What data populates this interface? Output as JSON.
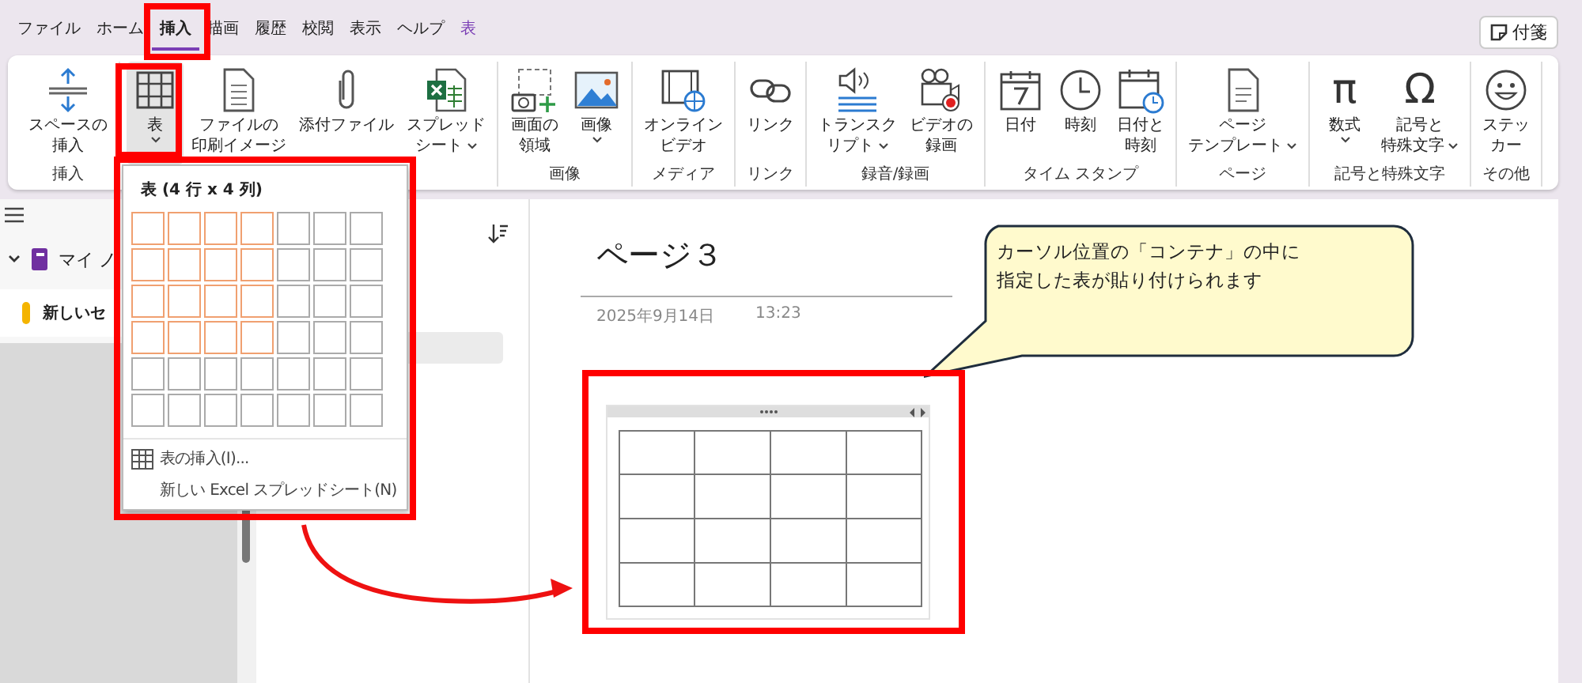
{
  "menu_tabs": [
    {
      "label": "ファイル",
      "selected": false,
      "kind": "normal"
    },
    {
      "label": "ホーム",
      "selected": false,
      "kind": "normal"
    },
    {
      "label": "挿入",
      "selected": true,
      "kind": "normal"
    },
    {
      "label": "描画",
      "selected": false,
      "kind": "normal"
    },
    {
      "label": "履歴",
      "selected": false,
      "kind": "normal"
    },
    {
      "label": "校閲",
      "selected": false,
      "kind": "normal"
    },
    {
      "label": "表示",
      "selected": false,
      "kind": "normal"
    },
    {
      "label": "ヘルプ",
      "selected": false,
      "kind": "normal"
    },
    {
      "label": "表",
      "selected": false,
      "kind": "contextual"
    }
  ],
  "sticky_notes_button": "付箋",
  "ribbon_groups": [
    {
      "items": [
        {
          "kind": "space",
          "lines": [
            "スペースの",
            "挿入"
          ],
          "dropdown": false,
          "selected": false
        }
      ],
      "label": "挿入"
    },
    {
      "items": [
        {
          "kind": "table",
          "lines": [
            "表"
          ],
          "dropdown": true,
          "selected": true
        },
        {
          "kind": "printout",
          "lines": [
            "ファイルの",
            "印刷イメージ"
          ],
          "dropdown": false,
          "selected": false
        },
        {
          "kind": "attachment",
          "lines": [
            "添付ファイル"
          ],
          "dropdown": false,
          "selected": false
        },
        {
          "kind": "spreadsheet",
          "lines": [
            "スプレッド",
            "シート"
          ],
          "dropdown": true,
          "selected": false
        }
      ]
    },
    {
      "items": [
        {
          "kind": "screen-clip",
          "lines": [
            "画面の",
            "領域"
          ],
          "dropdown": false,
          "selected": false
        },
        {
          "kind": "image",
          "lines": [
            "画像"
          ],
          "dropdown": true,
          "selected": false
        }
      ],
      "label": "画像"
    },
    {
      "items": [
        {
          "kind": "online-video",
          "lines": [
            "オンライン",
            "ビデオ"
          ],
          "dropdown": false,
          "selected": false
        }
      ],
      "label": "メディア"
    },
    {
      "items": [
        {
          "kind": "link",
          "lines": [
            "リンク"
          ],
          "dropdown": false,
          "selected": false
        }
      ],
      "label": "リンク"
    },
    {
      "items": [
        {
          "kind": "transcribe",
          "lines": [
            "トランスク",
            "リプト"
          ],
          "dropdown": true,
          "selected": false
        },
        {
          "kind": "video-record",
          "lines": [
            "ビデオの",
            "録画"
          ],
          "dropdown": false,
          "selected": false
        }
      ],
      "label": "録音/録画"
    },
    {
      "items": [
        {
          "kind": "date",
          "lines": [
            "日付"
          ],
          "dropdown": false,
          "selected": false
        },
        {
          "kind": "time",
          "lines": [
            "時刻"
          ],
          "dropdown": false,
          "selected": false
        },
        {
          "kind": "date-time",
          "lines": [
            "日付と",
            "時刻"
          ],
          "dropdown": false,
          "selected": false
        }
      ],
      "label": "タイム スタンプ"
    },
    {
      "items": [
        {
          "kind": "page-template",
          "lines": [
            "ページ",
            "テンプレート"
          ],
          "dropdown": true,
          "selected": false
        }
      ],
      "label": "ページ"
    },
    {
      "items": [
        {
          "kind": "glyph",
          "glyph": "π",
          "lines": [
            "数式"
          ],
          "dropdown": true,
          "selected": false
        },
        {
          "kind": "glyph",
          "glyph": "Ω",
          "lines": [
            "記号と",
            "特殊文字"
          ],
          "dropdown": true,
          "selected": false
        }
      ],
      "label": "記号と特殊文字"
    },
    {
      "items": [
        {
          "kind": "sticker",
          "lines": [
            "ステッ",
            "カー"
          ],
          "dropdown": false,
          "selected": false
        }
      ],
      "label": "その他"
    }
  ],
  "nav": {
    "notebook": "マイ ノ",
    "section": "新しいセ"
  },
  "table_dropdown": {
    "title": "表 (4 行 x 4 列)",
    "grid": [
      {
        "cells": [
          {
            "selected": true
          },
          {
            "selected": true
          },
          {
            "selected": true
          },
          {
            "selected": true
          },
          {
            "selected": false
          },
          {
            "selected": false
          },
          {
            "selected": false
          }
        ]
      },
      {
        "cells": [
          {
            "selected": true
          },
          {
            "selected": true
          },
          {
            "selected": true
          },
          {
            "selected": true
          },
          {
            "selected": false
          },
          {
            "selected": false
          },
          {
            "selected": false
          }
        ]
      },
      {
        "cells": [
          {
            "selected": true
          },
          {
            "selected": true
          },
          {
            "selected": true
          },
          {
            "selected": true
          },
          {
            "selected": false
          },
          {
            "selected": false
          },
          {
            "selected": false
          }
        ]
      },
      {
        "cells": [
          {
            "selected": true
          },
          {
            "selected": true
          },
          {
            "selected": true
          },
          {
            "selected": true
          },
          {
            "selected": false
          },
          {
            "selected": false
          },
          {
            "selected": false
          }
        ]
      },
      {
        "cells": [
          {
            "selected": false
          },
          {
            "selected": false
          },
          {
            "selected": false
          },
          {
            "selected": false
          },
          {
            "selected": false
          },
          {
            "selected": false
          },
          {
            "selected": false
          }
        ]
      },
      {
        "cells": [
          {
            "selected": false
          },
          {
            "selected": false
          },
          {
            "selected": false
          },
          {
            "selected": false
          },
          {
            "selected": false
          },
          {
            "selected": false
          },
          {
            "selected": false
          }
        ]
      }
    ],
    "menu": [
      {
        "kind": "insert-table",
        "label": "表の挿入(I)..."
      },
      {
        "kind": "plain",
        "label": "新しい Excel スプレッドシート(N)"
      }
    ]
  },
  "page": {
    "title": "ページ３",
    "date": "2025年9月14日",
    "time": "13:23"
  },
  "callout": [
    "カーソル位置の「コンテナ」の中に",
    "指定した表が貼り付けられます"
  ]
}
